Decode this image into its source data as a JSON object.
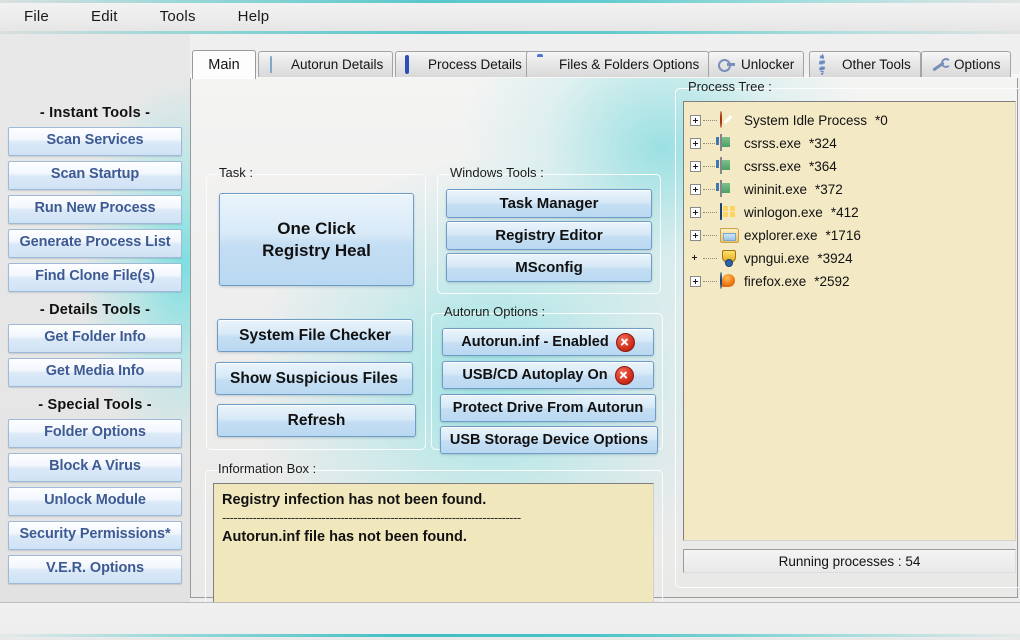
{
  "menu": {
    "items": [
      {
        "label": "File"
      },
      {
        "label": "Edit"
      },
      {
        "label": "Tools"
      },
      {
        "label": "Help"
      }
    ]
  },
  "sidebar": {
    "sections": [
      {
        "heading": "- Instant Tools -",
        "buttons": [
          {
            "label": "Scan Services"
          },
          {
            "label": "Scan Startup"
          },
          {
            "label": "Run New Process"
          },
          {
            "label": "Generate Process List"
          },
          {
            "label": "Find Clone File(s)"
          }
        ]
      },
      {
        "heading": "- Details Tools -",
        "buttons": [
          {
            "label": "Get Folder Info"
          },
          {
            "label": "Get Media Info"
          }
        ]
      },
      {
        "heading": "- Special Tools -",
        "buttons": [
          {
            "label": "Folder Options"
          },
          {
            "label": "Block A Virus"
          },
          {
            "label": "Unlock Module"
          },
          {
            "label": "Security Permissions*"
          },
          {
            "label": "V.E.R. Options"
          }
        ]
      }
    ]
  },
  "tabs": [
    {
      "label": "Main",
      "icon": "none",
      "active": true
    },
    {
      "label": "Autorun Details",
      "icon": "page-icon",
      "active": false
    },
    {
      "label": "Process Details",
      "icon": "window-icon",
      "active": false
    },
    {
      "label": "Files & Folders Options",
      "icon": "folder-icon",
      "active": false
    },
    {
      "label": "Unlocker",
      "icon": "key-icon",
      "active": false
    },
    {
      "label": "Other Tools",
      "icon": "gear-icon",
      "active": false
    },
    {
      "label": "Options",
      "icon": "wrench-icon",
      "active": false
    }
  ],
  "task_panel": {
    "legend": "Task :",
    "primary_button": {
      "line1": "One Click",
      "line2": "Registry Heal"
    },
    "buttons": [
      {
        "label": "System File Checker"
      },
      {
        "label": "Show Suspicious Files"
      },
      {
        "label": "Refresh"
      }
    ]
  },
  "windows_tools": {
    "legend": "Windows Tools :",
    "buttons": [
      {
        "label": "Task Manager"
      },
      {
        "label": "Registry Editor"
      },
      {
        "label": "MSconfig"
      }
    ]
  },
  "autorun_options": {
    "legend": "Autorun Options :",
    "buttons": [
      {
        "label": "Autorun.inf - Enabled",
        "badge": "red-x-icon"
      },
      {
        "label": "USB/CD Autoplay On",
        "badge": "red-x-icon"
      },
      {
        "label": "Protect Drive From Autorun",
        "badge": "none"
      },
      {
        "label": "USB Storage Device Options",
        "badge": "none"
      }
    ]
  },
  "information_box": {
    "legend": "Information Box :",
    "line1": "Registry infection has not been found.",
    "separator": "------------------------------------------------------------------------------",
    "line2": "Autorun.inf file has not been found."
  },
  "process_tree": {
    "legend": "Process Tree :",
    "rows": [
      {
        "name": "System Idle Process",
        "pid": "*0",
        "icon": "deny-icon",
        "expandable": true
      },
      {
        "name": "csrss.exe",
        "pid": "*324",
        "icon": "console-icon",
        "expandable": true
      },
      {
        "name": "csrss.exe",
        "pid": "*364",
        "icon": "console-icon",
        "expandable": true
      },
      {
        "name": "wininit.exe",
        "pid": "*372",
        "icon": "console-icon",
        "expandable": true
      },
      {
        "name": "winlogon.exe",
        "pid": "*412",
        "icon": "logon-icon",
        "expandable": true
      },
      {
        "name": "explorer.exe",
        "pid": "*1716",
        "icon": "folder-icon",
        "expandable": true
      },
      {
        "name": "vpngui.exe",
        "pid": "*3924",
        "icon": "shield-icon",
        "expandable": false
      },
      {
        "name": "firefox.exe",
        "pid": "*2592",
        "icon": "firefox-icon",
        "expandable": true
      }
    ],
    "status": "Running processes : 54"
  },
  "colors": {
    "accent_teal": "#49c3c6",
    "sidebar_button_text": "#3d5a92",
    "info_box_background": "#f0e7bc",
    "tree_background": "#f3e9c4",
    "badge_red": "#d42f1c"
  }
}
